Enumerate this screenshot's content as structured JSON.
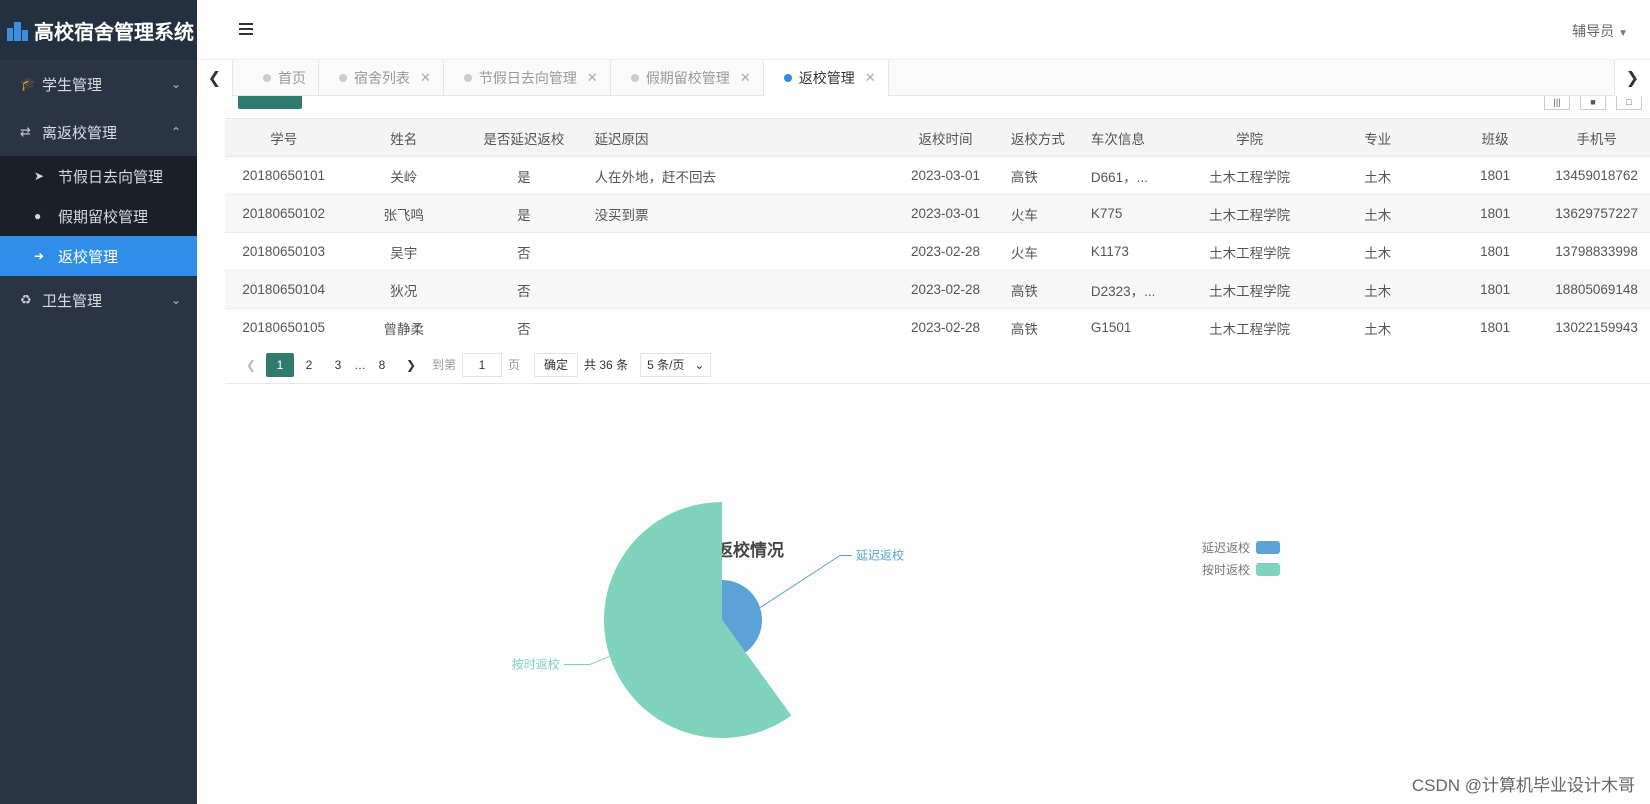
{
  "app": {
    "title": "高校宿舍管理系统"
  },
  "sidebar": {
    "groups": [
      {
        "label": "学生管理",
        "icon": "graduation-cap-icon"
      },
      {
        "label": "离返校管理",
        "icon": "exchange-icon"
      },
      {
        "label": "卫生管理",
        "icon": "recycle-icon"
      }
    ],
    "sub_items": [
      {
        "label": "节假日去向管理",
        "icon": "sign-out-icon"
      },
      {
        "label": "假期留校管理",
        "icon": "globe-icon"
      },
      {
        "label": "返校管理",
        "icon": "sign-in-icon"
      }
    ]
  },
  "header": {
    "user": "辅导员"
  },
  "tabs": [
    {
      "label": "首页"
    },
    {
      "label": "宿舍列表"
    },
    {
      "label": "节假日去向管理"
    },
    {
      "label": "假期留校管理"
    },
    {
      "label": "返校管理"
    }
  ],
  "table": {
    "headers": [
      "学号",
      "姓名",
      "是否延迟返校",
      "延迟原因",
      "返校时间",
      "返校方式",
      "车次信息",
      "学院",
      "专业",
      "班级",
      "手机号"
    ],
    "rows": [
      [
        "20180650101",
        "关岭",
        "是",
        "人在外地，赶不回去",
        "2023-03-01",
        "高铁",
        "D661，...",
        "土木工程学院",
        "土木",
        "1801",
        "13459018762"
      ],
      [
        "20180650102",
        "张飞鸣",
        "是",
        "没买到票",
        "2023-03-01",
        "火车",
        "K775",
        "土木工程学院",
        "土木",
        "1801",
        "13629757227"
      ],
      [
        "20180650103",
        "吴宇",
        "否",
        "",
        "2023-02-28",
        "火车",
        "K1173",
        "土木工程学院",
        "土木",
        "1801",
        "13798833998"
      ],
      [
        "20180650104",
        "狄况",
        "否",
        "",
        "2023-02-28",
        "高铁",
        "D2323，...",
        "土木工程学院",
        "土木",
        "1801",
        "18805069148"
      ],
      [
        "20180650105",
        "曾静柔",
        "否",
        "",
        "2023-02-28",
        "高铁",
        "G1501",
        "土木工程学院",
        "土木",
        "1801",
        "13022159943"
      ]
    ]
  },
  "pager": {
    "pages": [
      "1",
      "2",
      "3",
      "…",
      "8"
    ],
    "goto_label": "到第",
    "goto_value": "1",
    "page_unit": "页",
    "confirm": "确定",
    "total": "共 36 条",
    "page_size": "5 条/页"
  },
  "chart_data": {
    "type": "pie",
    "title": "学生返校情况",
    "legend": [
      "延迟返校",
      "按时返校"
    ],
    "legend_position": "top-right",
    "slices": [
      {
        "label": "延迟返校",
        "value": 2,
        "color": "#5ba3d6"
      },
      {
        "label": "按时返校",
        "value": 3,
        "color": "#7fd2bc"
      }
    ]
  },
  "watermark": "CSDN @计算机毕业设计木哥"
}
